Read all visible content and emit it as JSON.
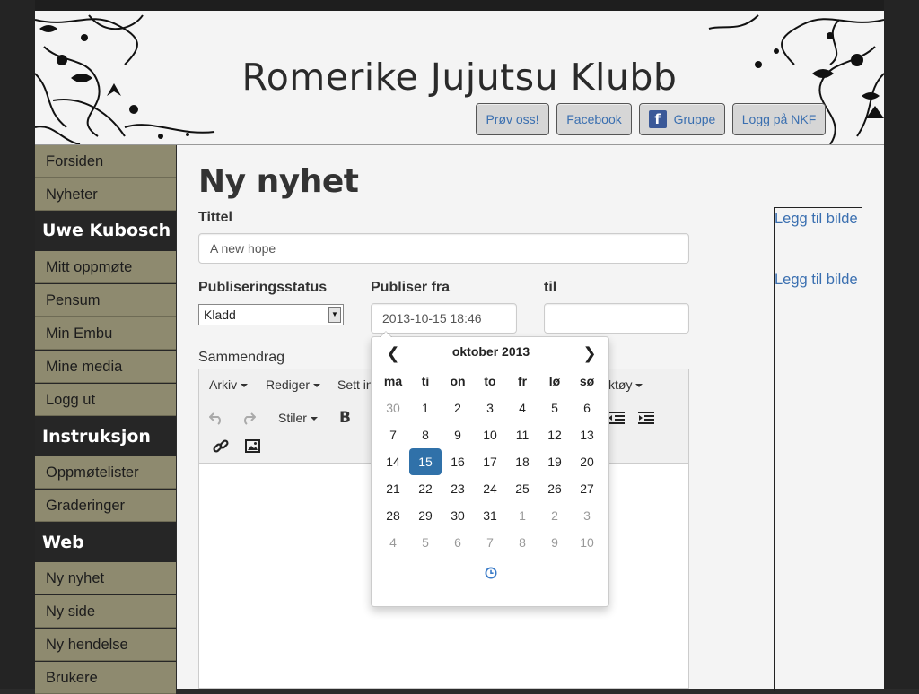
{
  "header": {
    "title": "Romerike Jujutsu Klubb",
    "buttons": {
      "try": "Prøv oss!",
      "facebook": "Facebook",
      "group": "Gruppe",
      "nkf_login": "Logg på NKF"
    },
    "fb_glyph": "f"
  },
  "sidebar": {
    "top_items": [
      "Forsiden",
      "Nyheter"
    ],
    "user_heading": "Uwe Kubosch",
    "user_items": [
      "Mitt oppmøte",
      "Pensum",
      "Min Embu",
      "Mine media",
      "Logg ut"
    ],
    "instruction_heading": "Instruksjon",
    "instruction_items": [
      "Oppmøtelister",
      "Graderinger"
    ],
    "web_heading": "Web",
    "web_items": [
      "Ny nyhet",
      "Ny side",
      "Ny hendelse",
      "Brukere"
    ]
  },
  "form": {
    "page_title": "Ny nyhet",
    "title_label": "Tittel",
    "title_value": "A new hope",
    "status_label": "Publiseringsstatus",
    "status_value": "Kladd",
    "publish_from_label": "Publiser fra",
    "publish_from_value": "2013-10-15 18:46",
    "publish_to_label": "til",
    "publish_to_value": "",
    "summary_label": "Sammendrag"
  },
  "editor": {
    "menus": [
      "Arkiv",
      "Rediger",
      "Sett in",
      "ktøy"
    ],
    "style_dropdown": "Stiler",
    "bold_glyph": "B"
  },
  "side_links": [
    "Legg til bilde",
    "Legg til bilde"
  ],
  "datepicker": {
    "month_title": "oktober 2013",
    "weekdays": [
      "ma",
      "ti",
      "on",
      "to",
      "fr",
      "lø",
      "sø"
    ],
    "weeks": [
      [
        "30",
        "1",
        "2",
        "3",
        "4",
        "5",
        "6"
      ],
      [
        "7",
        "8",
        "9",
        "10",
        "11",
        "12",
        "13"
      ],
      [
        "14",
        "15",
        "16",
        "17",
        "18",
        "19",
        "20"
      ],
      [
        "21",
        "22",
        "23",
        "24",
        "25",
        "26",
        "27"
      ],
      [
        "28",
        "29",
        "30",
        "31",
        "1",
        "2",
        "3"
      ],
      [
        "4",
        "5",
        "6",
        "7",
        "8",
        "9",
        "10"
      ]
    ],
    "selected_day": "15",
    "prev_glyph": "❮",
    "next_glyph": "❯"
  },
  "colors": {
    "nav_bg": "#8e8a6f",
    "nav_heading_bg": "#262626",
    "link": "#3a6fb0",
    "selected_day": "#3071a9"
  }
}
